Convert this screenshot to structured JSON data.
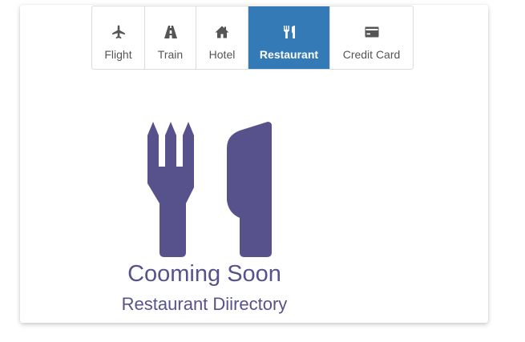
{
  "tabs": [
    {
      "label": "Flight",
      "icon": "plane-icon",
      "active": false
    },
    {
      "label": "Train",
      "icon": "road-icon",
      "active": false
    },
    {
      "label": "Hotel",
      "icon": "home-icon",
      "active": false
    },
    {
      "label": "Restaurant",
      "icon": "cutlery-icon",
      "active": true
    },
    {
      "label": "Credit Card",
      "icon": "credit-card-icon",
      "active": false
    }
  ],
  "content": {
    "icon": "cutlery-icon",
    "heading": "Cooming Soon",
    "subheading": "Restaurant Diirectory"
  },
  "colors": {
    "accent": "#337ab7",
    "illustration": "#58528c",
    "tab_text": "#555555"
  }
}
